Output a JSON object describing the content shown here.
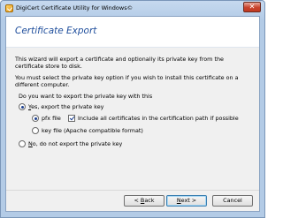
{
  "window": {
    "title": "DigiCert Certificate Utility for Windows©",
    "close_symbol": "✕"
  },
  "header": {
    "title": "Certificate Export"
  },
  "body": {
    "intro": "This wizard will export a certificate and optionally its private key from the certificate store to disk.",
    "instruction": "You must select the private key option if you wish to install this certificate on a different computer.",
    "question": "Do you want to export the private key with this"
  },
  "options": {
    "export_yes": {
      "prefix": "",
      "accel": "Y",
      "rest": "es, export the private key",
      "checked": true
    },
    "pfx_file": {
      "label": "pfx file",
      "checked": true
    },
    "include_all": {
      "label": "Include all certificates in the certification path if possible",
      "checked": true
    },
    "key_file": {
      "label": "key file (Apache compatible format)",
      "checked": false
    },
    "export_no": {
      "accel": "N",
      "rest": "o, do not export the private key",
      "checked": false
    }
  },
  "buttons": {
    "back": {
      "prefix": "< ",
      "accel": "B",
      "rest": "ack"
    },
    "next": {
      "accel": "N",
      "rest": "ext >"
    },
    "cancel": {
      "label": "Cancel"
    }
  }
}
